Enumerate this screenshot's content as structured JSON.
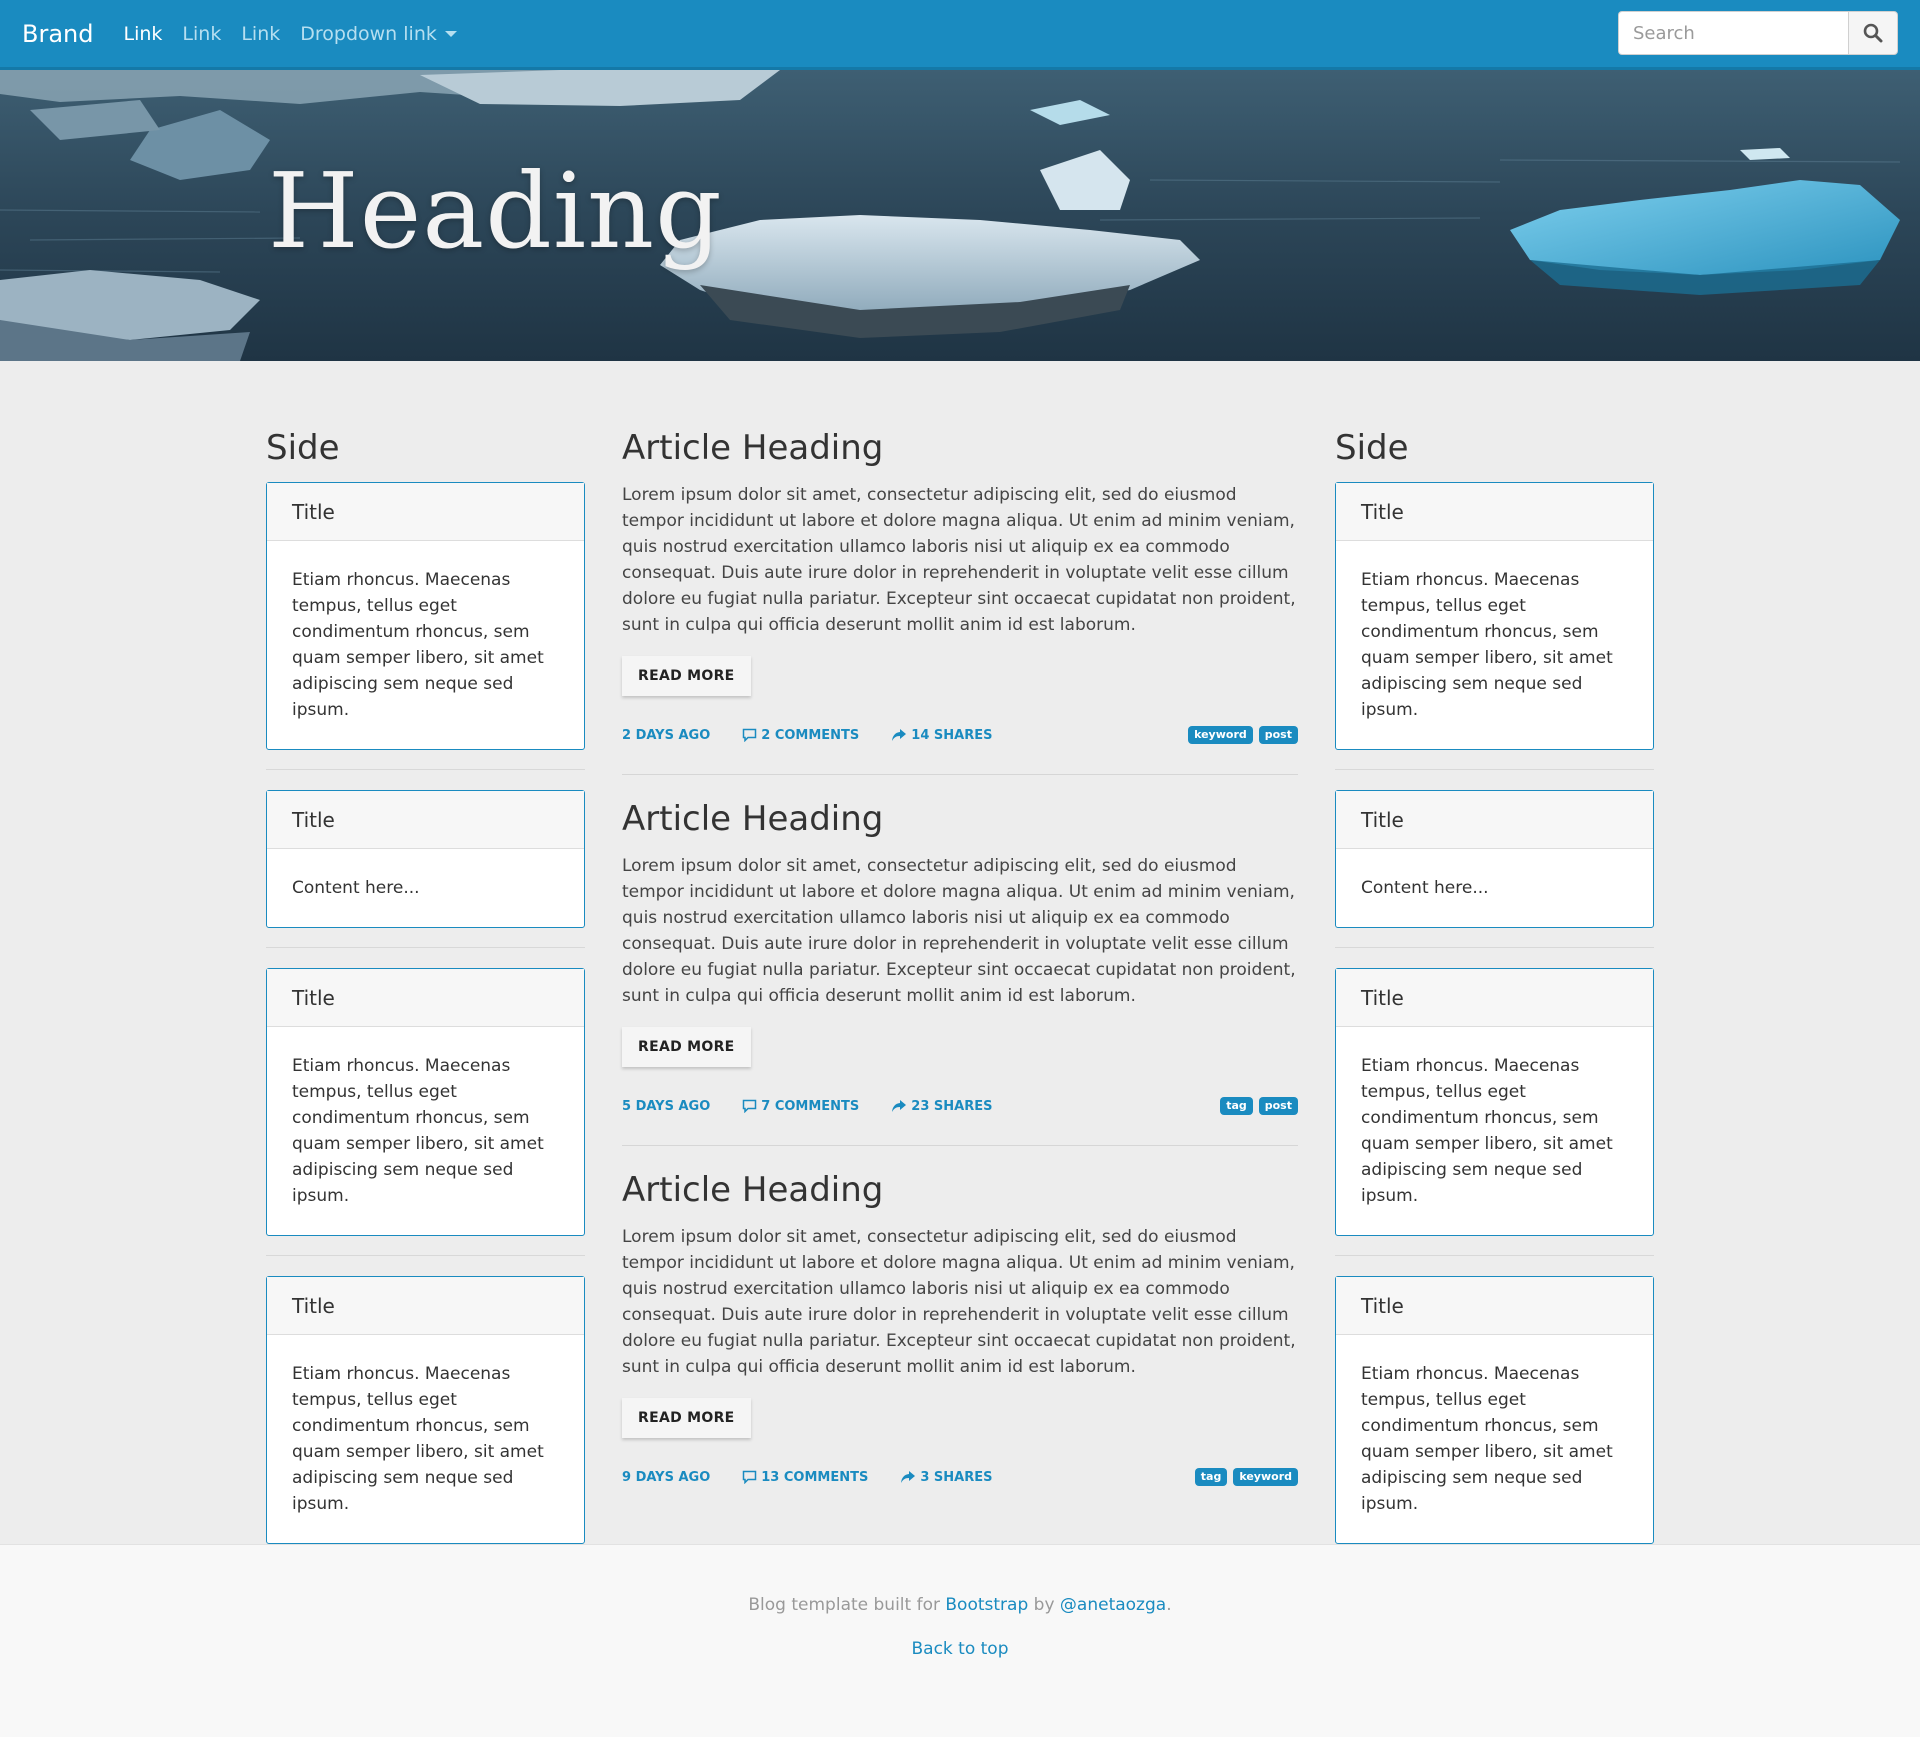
{
  "navbar": {
    "brand": "Brand",
    "links": [
      "Link",
      "Link",
      "Link"
    ],
    "dropdown_label": "Dropdown link",
    "search_placeholder": "Search",
    "color": "#1a8bc0"
  },
  "hero": {
    "heading": "Heading"
  },
  "left_side": {
    "title": "Side",
    "cards": [
      {
        "title": "Title",
        "body": "Etiam rhoncus. Maecenas tempus, tellus eget condimentum rhoncus, sem quam semper libero, sit amet adipiscing sem neque sed ipsum."
      },
      {
        "title": "Title",
        "body": "Content here..."
      },
      {
        "title": "Title",
        "body": "Etiam rhoncus. Maecenas tempus, tellus eget condimentum rhoncus, sem quam semper libero, sit amet adipiscing sem neque sed ipsum."
      },
      {
        "title": "Title",
        "body": "Etiam rhoncus. Maecenas tempus, tellus eget condimentum rhoncus, sem quam semper libero, sit amet adipiscing sem neque sed ipsum."
      }
    ]
  },
  "right_side": {
    "title": "Side",
    "cards": [
      {
        "title": "Title",
        "body": "Etiam rhoncus. Maecenas tempus, tellus eget condimentum rhoncus, sem quam semper libero, sit amet adipiscing sem neque sed ipsum."
      },
      {
        "title": "Title",
        "body": "Content here..."
      },
      {
        "title": "Title",
        "body": "Etiam rhoncus. Maecenas tempus, tellus eget condimentum rhoncus, sem quam semper libero, sit amet adipiscing sem neque sed ipsum."
      },
      {
        "title": "Title",
        "body": "Etiam rhoncus. Maecenas tempus, tellus eget condimentum rhoncus, sem quam semper libero, sit amet adipiscing sem neque sed ipsum."
      }
    ]
  },
  "articles": [
    {
      "heading": "Article Heading",
      "text": "Lorem ipsum dolor sit amet, consectetur adipiscing elit, sed do eiusmod tempor incididunt ut labore et dolore magna aliqua. Ut enim ad minim veniam, quis nostrud exercitation ullamco laboris nisi ut aliquip ex ea commodo consequat. Duis aute irure dolor in reprehenderit in voluptate velit esse cillum dolore eu fugiat nulla pariatur. Excepteur sint occaecat cupidatat non proident, sunt in culpa qui officia deserunt mollit anim id est laborum.",
      "read_more": "READ MORE",
      "date": "2 DAYS AGO",
      "comments": "2 COMMENTS",
      "shares": "14 SHARES",
      "tags": [
        "keyword",
        "post"
      ]
    },
    {
      "heading": "Article Heading",
      "text": "Lorem ipsum dolor sit amet, consectetur adipiscing elit, sed do eiusmod tempor incididunt ut labore et dolore magna aliqua. Ut enim ad minim veniam, quis nostrud exercitation ullamco laboris nisi ut aliquip ex ea commodo consequat. Duis aute irure dolor in reprehenderit in voluptate velit esse cillum dolore eu fugiat nulla pariatur. Excepteur sint occaecat cupidatat non proident, sunt in culpa qui officia deserunt mollit anim id est laborum.",
      "read_more": "READ MORE",
      "date": "5 DAYS AGO",
      "comments": "7 COMMENTS",
      "shares": "23 SHARES",
      "tags": [
        "tag",
        "post"
      ]
    },
    {
      "heading": "Article Heading",
      "text": "Lorem ipsum dolor sit amet, consectetur adipiscing elit, sed do eiusmod tempor incididunt ut labore et dolore magna aliqua. Ut enim ad minim veniam, quis nostrud exercitation ullamco laboris nisi ut aliquip ex ea commodo consequat. Duis aute irure dolor in reprehenderit in voluptate velit esse cillum dolore eu fugiat nulla pariatur. Excepteur sint occaecat cupidatat non proident, sunt in culpa qui officia deserunt mollit anim id est laborum.",
      "read_more": "READ MORE",
      "date": "9 DAYS AGO",
      "comments": "13 COMMENTS",
      "shares": "3 SHARES",
      "tags": [
        "tag",
        "keyword"
      ]
    }
  ],
  "footer": {
    "text_before": "Blog template built for ",
    "bootstrap_link": "Bootstrap",
    "text_middle": " by ",
    "author_link": "@anetaozga",
    "text_after": ".",
    "back_to_top": "Back to top"
  }
}
